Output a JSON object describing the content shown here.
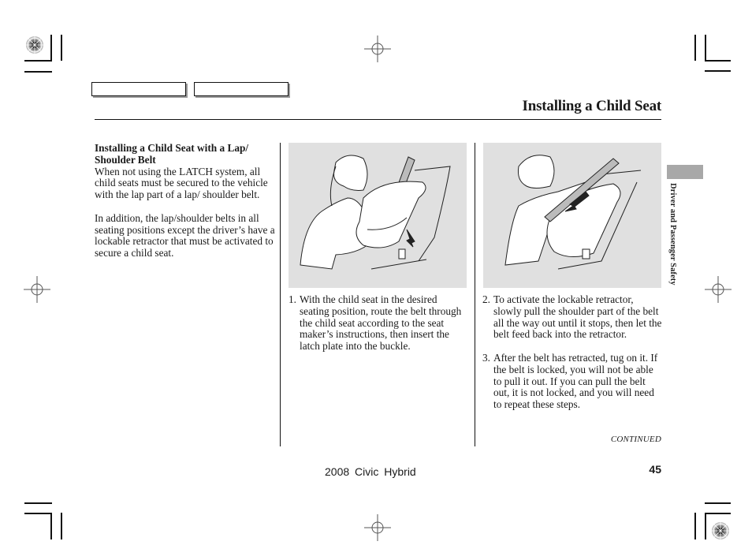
{
  "header": {
    "section_title": "Installing a Child Seat",
    "tab_boxes": [
      "",
      ""
    ]
  },
  "side_tab": {
    "label": "Driver and Passenger Safety",
    "color": "#a8a8a8"
  },
  "left_column": {
    "heading": "Installing a Child Seat with a Lap/ Shoulder Belt",
    "paragraphs": [
      "When not using the LATCH system, all child seats must be secured to the vehicle with the lap part of a lap/ shoulder belt.",
      "In addition, the lap/shoulder belts in all seating positions except the driver’s have a lockable retractor that must be activated to secure a child seat."
    ]
  },
  "middle_column": {
    "illustration": "woman-routing-belt-through-child-seat",
    "steps": [
      {
        "number": "1.",
        "text": "With the child seat in the desired seating position, route the belt through the child seat according to the seat maker’s instructions, then insert the latch plate into the buckle."
      }
    ]
  },
  "right_column": {
    "illustration": "woman-pulling-shoulder-belt-out",
    "steps": [
      {
        "number": "2.",
        "text": "To activate the lockable retractor, slowly pull the shoulder part of the belt all the way out until it stops, then let the belt feed back into the retractor."
      },
      {
        "number": "3.",
        "text": "After the belt has retracted, tug on it. If the belt is locked, you will not be able to pull it out. If you can pull the belt out, it is not locked, and you will need to repeat these steps."
      }
    ],
    "continued_label": "CONTINUED"
  },
  "footer": {
    "model": "2008 Civic Hybrid",
    "page_number": "45"
  },
  "colors": {
    "illustration_bg": "#e0e0e0",
    "text": "#1a1a1a"
  }
}
